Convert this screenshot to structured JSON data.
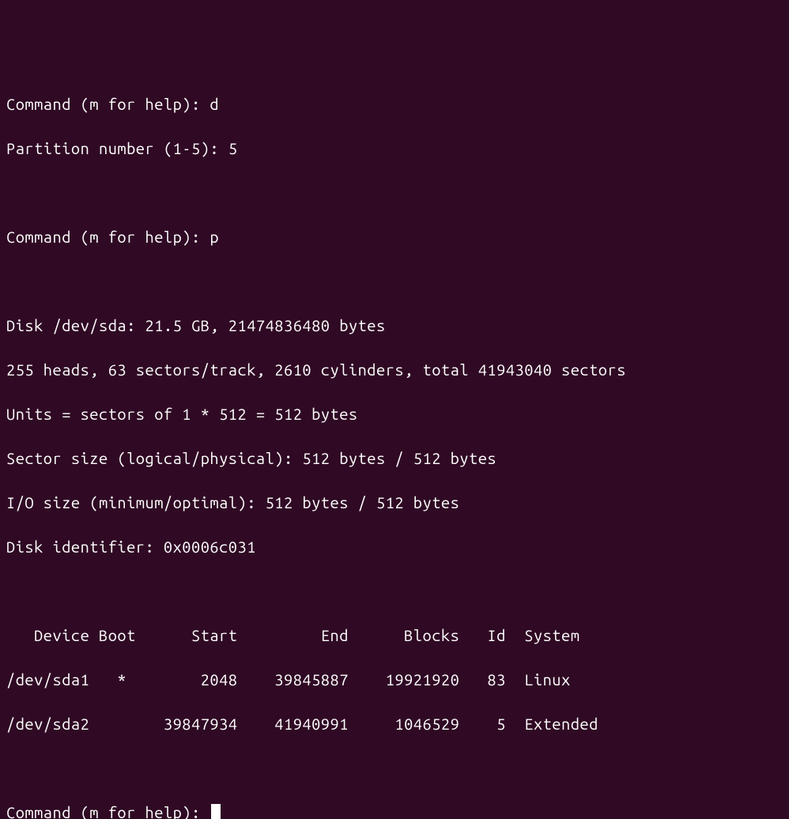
{
  "commands": {
    "prompt": "Command (m for help): ",
    "cmd1": "d",
    "partition_prompt": "Partition number (1-5): ",
    "partition_num": "5",
    "cmd2": "p"
  },
  "disk_info": {
    "line1": "Disk /dev/sda: 21.5 GB, 21474836480 bytes",
    "line2": "255 heads, 63 sectors/track, 2610 cylinders, total 41943040 sectors",
    "line3": "Units = sectors of 1 * 512 = 512 bytes",
    "line4": "Sector size (logical/physical): 512 bytes / 512 bytes",
    "line5": "I/O size (minimum/optimal): 512 bytes / 512 bytes",
    "line6": "Disk identifier: 0x0006c031"
  },
  "table": {
    "header": "   Device Boot      Start         End      Blocks   Id  System",
    "rows": [
      "/dev/sda1   *        2048    39845887    19921920   83  Linux",
      "/dev/sda2        39847934    41940991     1046529    5  Extended"
    ]
  },
  "chart_data": {
    "type": "table",
    "title": "fdisk partition table for /dev/sda",
    "columns": [
      "Device",
      "Boot",
      "Start",
      "End",
      "Blocks",
      "Id",
      "System"
    ],
    "rows": [
      {
        "Device": "/dev/sda1",
        "Boot": "*",
        "Start": 2048,
        "End": 39845887,
        "Blocks": 19921920,
        "Id": "83",
        "System": "Linux"
      },
      {
        "Device": "/dev/sda2",
        "Boot": "",
        "Start": 39847934,
        "End": 41940991,
        "Blocks": 1046529,
        "Id": "5",
        "System": "Extended"
      }
    ],
    "disk": {
      "path": "/dev/sda",
      "size_gb": 21.5,
      "size_bytes": 21474836480,
      "heads": 255,
      "sectors_per_track": 63,
      "cylinders": 2610,
      "total_sectors": 41943040,
      "unit_bytes": 512,
      "sector_size_logical": 512,
      "sector_size_physical": 512,
      "io_size_min": 512,
      "io_size_optimal": 512,
      "identifier": "0x0006c031"
    }
  }
}
